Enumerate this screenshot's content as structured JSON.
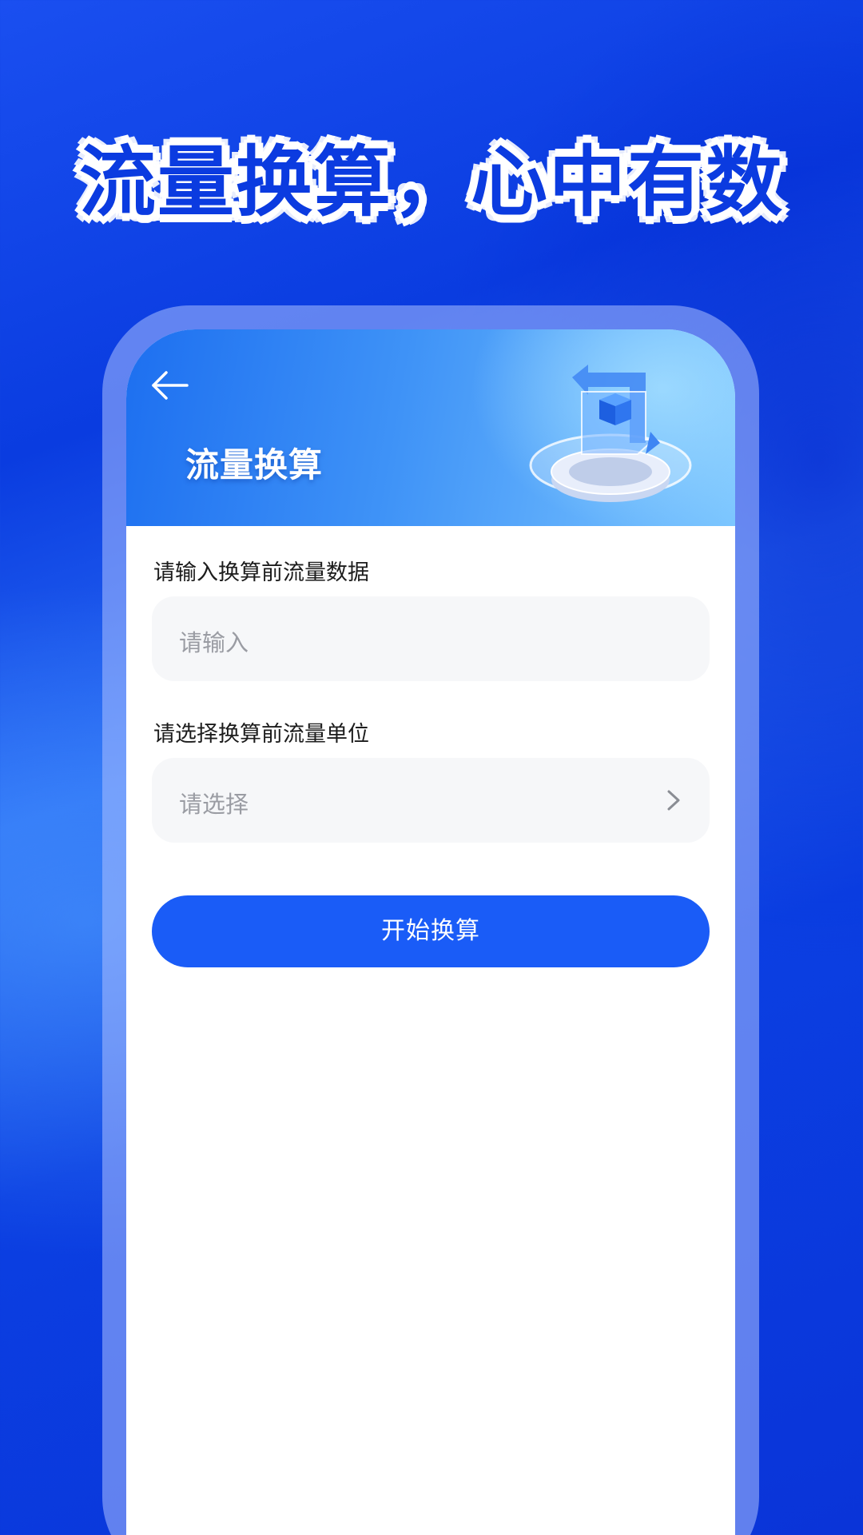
{
  "promo": {
    "headline": "流量换算，心中有数"
  },
  "header": {
    "title": "流量换算",
    "back_icon": "arrow-left-icon",
    "illustration": "data-cube-illustration"
  },
  "form": {
    "amount": {
      "label": "请输入换算前流量数据",
      "placeholder": "请输入",
      "value": ""
    },
    "unit": {
      "label": "请选择换算前流量单位",
      "placeholder": "请选择",
      "icon": "chevron-right-icon"
    },
    "submit_label": "开始换算"
  },
  "colors": {
    "primary": "#1a5cf7",
    "background": "#0a3ce0",
    "field_bg": "#f6f7f9",
    "placeholder": "#9a9ca3"
  }
}
